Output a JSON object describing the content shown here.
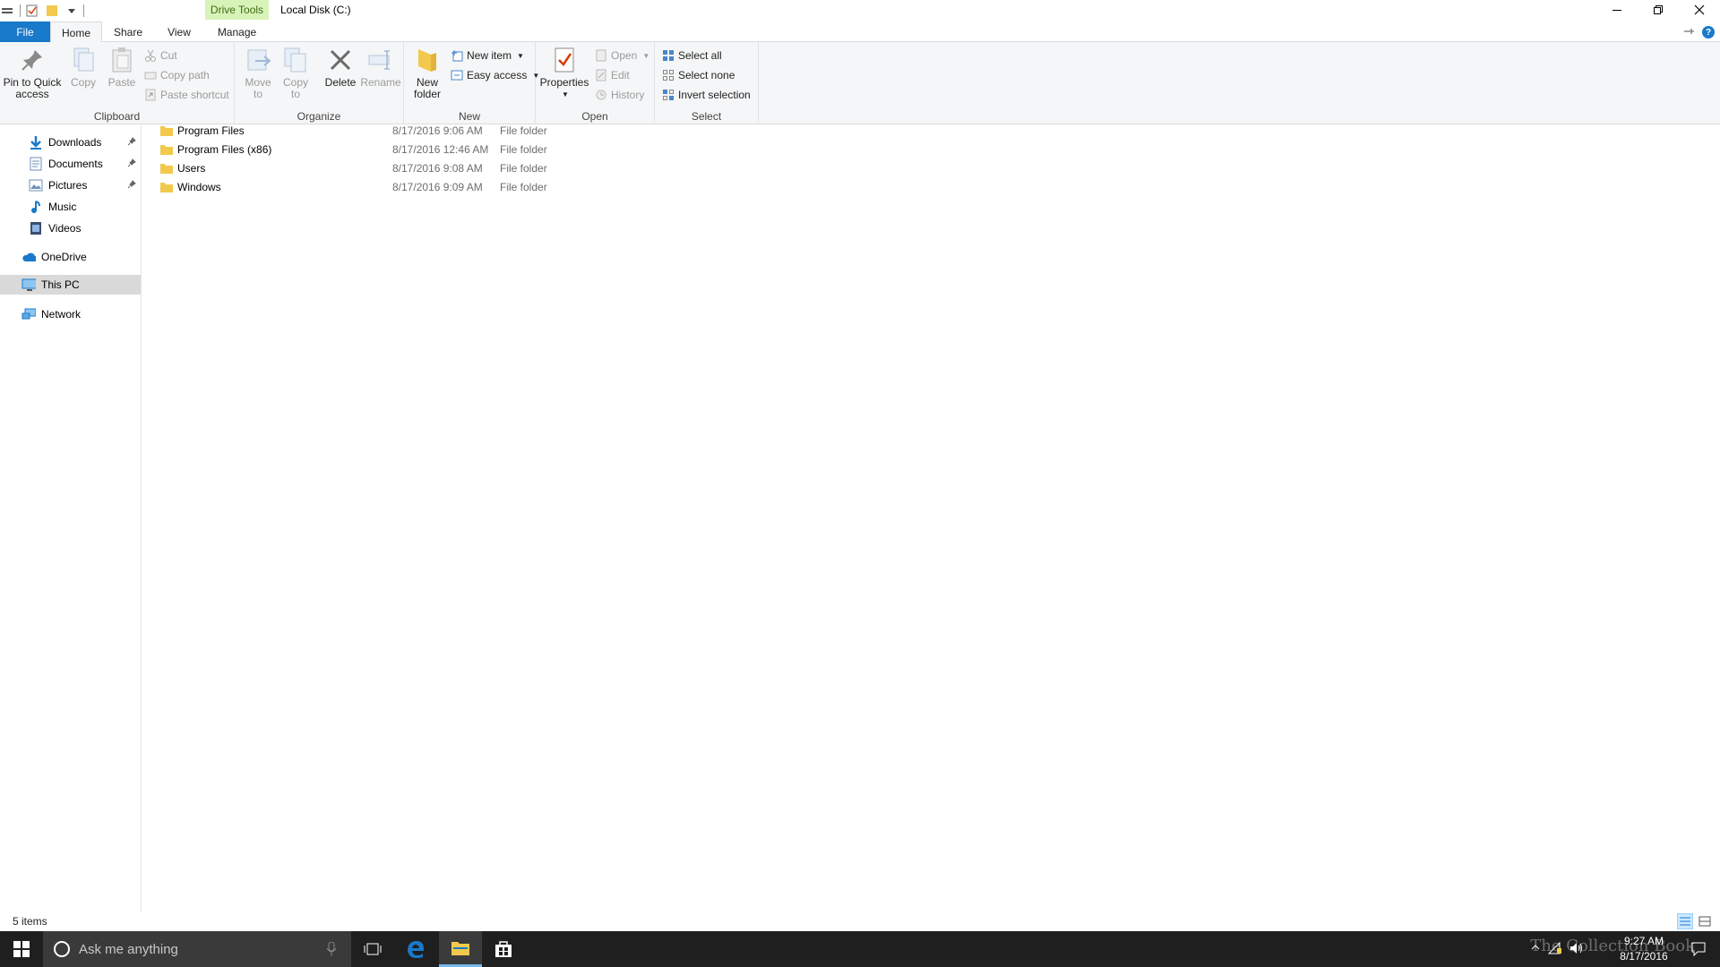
{
  "window": {
    "title": "Local Disk (C:)",
    "contextual_group": "Drive Tools"
  },
  "ribbon_tabs": {
    "file": "File",
    "home": "Home",
    "share": "Share",
    "view": "View",
    "manage": "Manage"
  },
  "ribbon": {
    "clipboard": {
      "label": "Clipboard",
      "pin": "Pin to Quick access",
      "copy": "Copy",
      "paste": "Paste",
      "cut": "Cut",
      "copy_path": "Copy path",
      "paste_shortcut": "Paste shortcut"
    },
    "organize": {
      "label": "Organize",
      "move_to": "Move to",
      "copy_to": "Copy to",
      "delete": "Delete",
      "rename": "Rename"
    },
    "new": {
      "label": "New",
      "new_folder": "New folder",
      "new_item": "New item",
      "easy_access": "Easy access"
    },
    "open": {
      "label": "Open",
      "properties": "Properties",
      "open": "Open",
      "edit": "Edit",
      "history": "History"
    },
    "select": {
      "label": "Select",
      "select_all": "Select all",
      "select_none": "Select none",
      "invert": "Invert selection"
    }
  },
  "nav": {
    "downloads": "Downloads",
    "documents": "Documents",
    "pictures": "Pictures",
    "music": "Music",
    "videos": "Videos",
    "onedrive": "OneDrive",
    "this_pc": "This PC",
    "network": "Network"
  },
  "files": [
    {
      "name": "Program Files",
      "date": "8/17/2016 9:06 AM",
      "type": "File folder"
    },
    {
      "name": "Program Files (x86)",
      "date": "8/17/2016 12:46 AM",
      "type": "File folder"
    },
    {
      "name": "Users",
      "date": "8/17/2016 9:08 AM",
      "type": "File folder"
    },
    {
      "name": "Windows",
      "date": "8/17/2016 9:09 AM",
      "type": "File folder"
    }
  ],
  "status": {
    "item_count": "5 items"
  },
  "taskbar": {
    "search_placeholder": "Ask me anything",
    "time": "9:27 AM",
    "date": "8/17/2016",
    "watermark": "The Collection Book"
  },
  "colors": {
    "file_tab": "#1979ca",
    "contextual_tab": "#d8f3b8",
    "folder": "#f2c94c",
    "taskbar": "#1f1f1f"
  }
}
